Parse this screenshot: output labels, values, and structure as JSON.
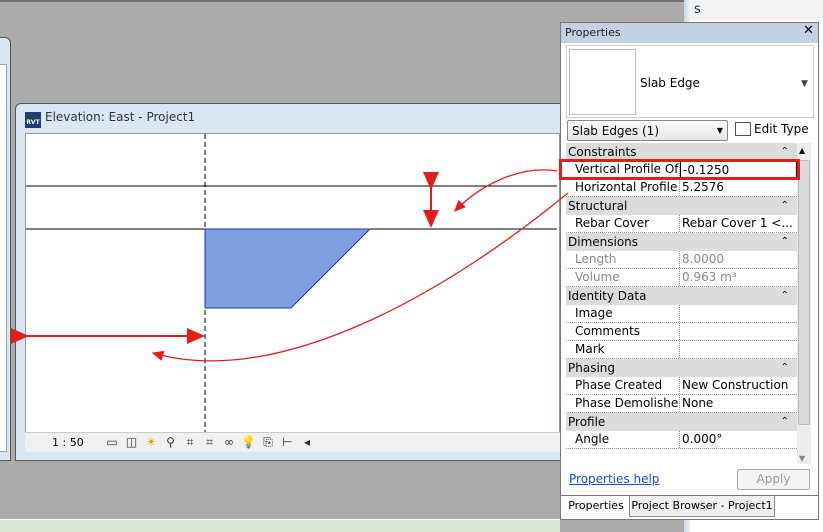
{
  "right_panel_fragment": "s",
  "elevation_window": {
    "title": "Elevation: East - Project1",
    "file_icon_label": "RVT",
    "scale": "1 : 50",
    "view_controls": [
      "detail-level-icon",
      "visual-style-icon",
      "sun-path-off-icon",
      "shadows-off-icon",
      "crop-view-off-icon",
      "show-crop-region-icon",
      "temporary-hide-icon",
      "reveal-hidden-icon",
      "temporary-view-properties-icon",
      "lock-3d-view-icon",
      "scroll-left-icon"
    ]
  },
  "properties": {
    "title": "Properties",
    "close": "✕",
    "type_name": "Slab Edge",
    "filter": "Slab Edges (1)",
    "edit_type": "Edit Type",
    "groups": [
      {
        "name": "Constraints",
        "rows": [
          {
            "label": "Vertical Profile Of...",
            "value": "-0.1250"
          },
          {
            "label": "Horizontal Profile ...",
            "value": "5.2576"
          }
        ]
      },
      {
        "name": "Structural",
        "rows": [
          {
            "label": "Rebar Cover",
            "value": "Rebar Cover 1 <..."
          }
        ]
      },
      {
        "name": "Dimensions",
        "rows": [
          {
            "label": "Length",
            "value": "8.0000",
            "readonly": true
          },
          {
            "label": "Volume",
            "value": "0.963 m³",
            "readonly": true
          }
        ]
      },
      {
        "name": "Identity Data",
        "rows": [
          {
            "label": "Image",
            "value": ""
          },
          {
            "label": "Comments",
            "value": ""
          },
          {
            "label": "Mark",
            "value": ""
          }
        ]
      },
      {
        "name": "Phasing",
        "rows": [
          {
            "label": "Phase Created",
            "value": "New Construction"
          },
          {
            "label": "Phase Demolished",
            "value": "None"
          }
        ]
      },
      {
        "name": "Profile",
        "rows": [
          {
            "label": "Angle",
            "value": "0.000°"
          }
        ]
      }
    ],
    "help_link": "Properties help",
    "apply": "Apply",
    "tabs": [
      "Properties",
      "Project Browser - Project1"
    ]
  },
  "colors": {
    "slab_fill": "#7f9ddf",
    "annotation": "#e41c1c",
    "highlight_box": "#e41c1c"
  }
}
